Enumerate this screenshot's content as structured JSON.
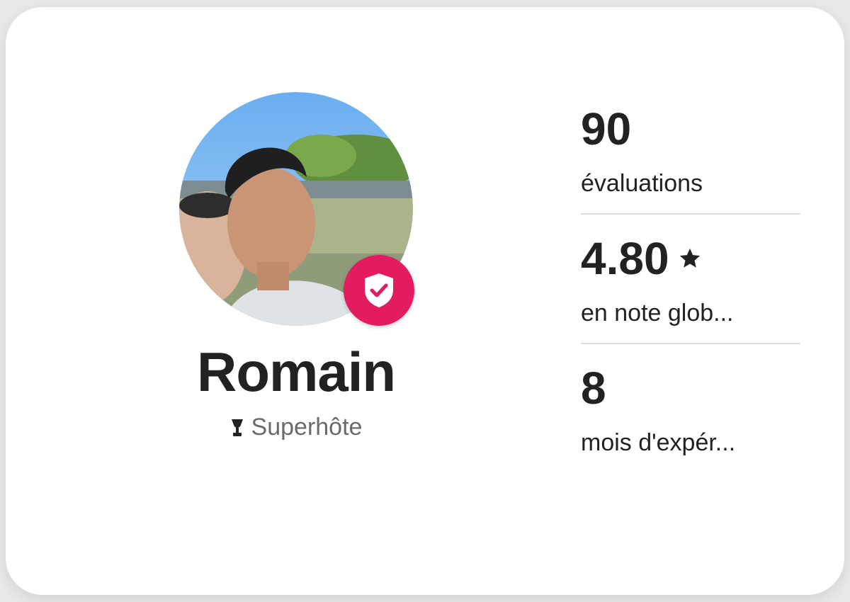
{
  "host": {
    "name": "Romain",
    "status": "Superhôte",
    "avatar_alt": "host-photo",
    "badge_icon": "verified-shield-check-icon",
    "status_icon": "superhost-trophy-icon"
  },
  "stats": [
    {
      "value": "90",
      "label": "évaluations"
    },
    {
      "value": "4.80",
      "label": "en note glob...",
      "icon": "star-icon"
    },
    {
      "value": "8",
      "label": "mois d'expér..."
    }
  ],
  "colors": {
    "accent": "#e31c5f",
    "text_primary": "#222222",
    "text_secondary": "#6a6a6a",
    "divider": "#dddddd"
  }
}
